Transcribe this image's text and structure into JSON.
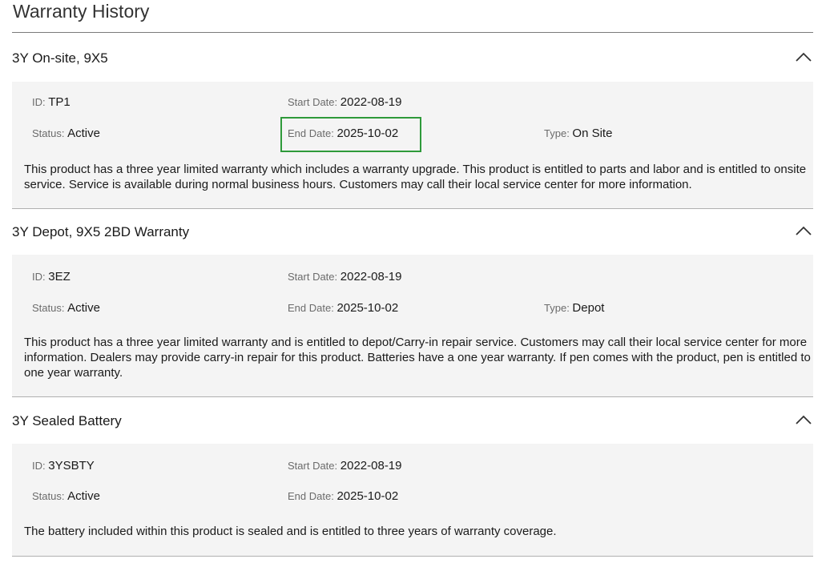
{
  "page": {
    "title": "Warranty History"
  },
  "warranties": [
    {
      "title": "3Y On-site, 9X5",
      "id_label": "ID",
      "id": "TP1",
      "start_label": "Start Date",
      "start_date": "2022-08-19",
      "status_label": "Status",
      "status": "Active",
      "end_label": "End Date",
      "end_date": "2025-10-02",
      "type_label": "Type",
      "type": "On Site",
      "description": "This product has a three year limited warranty which includes a warranty upgrade. This product is entitled to parts and labor and is entitled to onsite service. Service is available during normal business hours. Customers may call their local service center for more information.",
      "highlighted_field": "end_date"
    },
    {
      "title": "3Y Depot, 9X5 2BD Warranty",
      "id_label": "ID",
      "id": "3EZ",
      "start_label": "Start Date",
      "start_date": "2022-08-19",
      "status_label": "Status",
      "status": "Active",
      "end_label": "End Date",
      "end_date": "2025-10-02",
      "type_label": "Type",
      "type": "Depot",
      "description": "This product has a three year limited warranty and is entitled to depot/Carry-in repair service. Customers may call their local service center for more information. Dealers may provide carry-in repair for this product. Batteries have a one year warranty. If pen comes with the product, pen is entitled to one year warranty."
    },
    {
      "title": "3Y Sealed Battery",
      "id_label": "ID",
      "id": "3YSBTY",
      "start_label": "Start Date",
      "start_date": "2022-08-19",
      "status_label": "Status",
      "status": "Active",
      "end_label": "End Date",
      "end_date": "2025-10-02",
      "description": "The battery included within this product is sealed and is entitled to three years of warranty coverage."
    }
  ],
  "icons": {
    "collapse": "chevron-up-icon"
  },
  "colors": {
    "highlight": "#2e9a3a",
    "panel_bg": "#f4f4f4"
  }
}
